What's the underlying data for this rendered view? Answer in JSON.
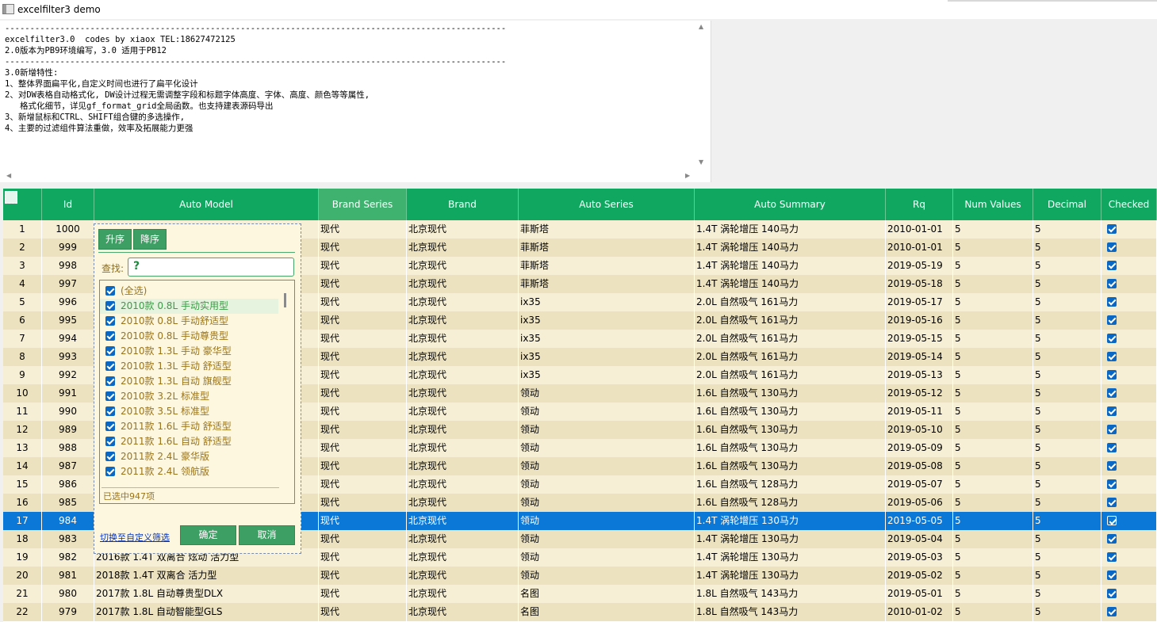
{
  "window": {
    "title": "excelfilter3 demo"
  },
  "memo": {
    "lines": [
      "----------------------------------------------------------------------------------------------------",
      "excelfilter3.0  codes by xiaox TEL:18627472125",
      "2.0版本为PB9环境编写，3.0 适用于PB12",
      "----------------------------------------------------------------------------------------------------",
      "3.0新增特性:",
      "1、整体界面扁平化,自定义时间也进行了扁平化设计",
      "2、对DW表格自动格式化, DW设计过程无需调整字段和标题字体高度、字体、高度、颜色等等属性,",
      "   格式化细节，详见gf_format_grid全局函数。也支持建表源码导出",
      "3、新增鼠标和CTRL、SHIFT组合键的多选操作,",
      "4、主要的过滤组件算法重做，效率及拓展能力更强"
    ]
  },
  "grid": {
    "headers": [
      "",
      "Id",
      "Auto Model",
      "Brand Series",
      "Brand",
      "Auto Series",
      "Auto Summary",
      "Rq",
      "Num Values",
      "Decimal Values",
      "Checked"
    ],
    "rows": [
      {
        "n": "1",
        "id": "1000",
        "model": "",
        "series": "现代",
        "brand": "北京现代",
        "auto": "菲斯塔",
        "summary": "1.4T 涡轮增压 140马力",
        "rq": "2010-01-01",
        "num": "5",
        "dec": "5",
        "checked": true
      },
      {
        "n": "2",
        "id": "999",
        "model": "",
        "series": "现代",
        "brand": "北京现代",
        "auto": "菲斯塔",
        "summary": "1.4T 涡轮增压 140马力",
        "rq": "2010-01-01",
        "num": "5",
        "dec": "5",
        "checked": true
      },
      {
        "n": "3",
        "id": "998",
        "model": "",
        "series": "现代",
        "brand": "北京现代",
        "auto": "菲斯塔",
        "summary": "1.4T 涡轮增压 140马力",
        "rq": "2019-05-19",
        "num": "5",
        "dec": "5",
        "checked": true
      },
      {
        "n": "4",
        "id": "997",
        "model": "",
        "series": "现代",
        "brand": "北京现代",
        "auto": "菲斯塔",
        "summary": "1.4T 涡轮增压 140马力",
        "rq": "2019-05-18",
        "num": "5",
        "dec": "5",
        "checked": true
      },
      {
        "n": "5",
        "id": "996",
        "model": "",
        "series": "现代",
        "brand": "北京现代",
        "auto": "ix35",
        "summary": "2.0L 自然吸气 161马力",
        "rq": "2019-05-17",
        "num": "5",
        "dec": "5",
        "checked": true
      },
      {
        "n": "6",
        "id": "995",
        "model": "",
        "series": "现代",
        "brand": "北京现代",
        "auto": "ix35",
        "summary": "2.0L 自然吸气 161马力",
        "rq": "2019-05-16",
        "num": "5",
        "dec": "5",
        "checked": true
      },
      {
        "n": "7",
        "id": "994",
        "model": "",
        "series": "现代",
        "brand": "北京现代",
        "auto": "ix35",
        "summary": "2.0L 自然吸气 161马力",
        "rq": "2019-05-15",
        "num": "5",
        "dec": "5",
        "checked": true
      },
      {
        "n": "8",
        "id": "993",
        "model": "",
        "series": "现代",
        "brand": "北京现代",
        "auto": "ix35",
        "summary": "2.0L 自然吸气 161马力",
        "rq": "2019-05-14",
        "num": "5",
        "dec": "5",
        "checked": true
      },
      {
        "n": "9",
        "id": "992",
        "model": "",
        "series": "现代",
        "brand": "北京现代",
        "auto": "ix35",
        "summary": "2.0L 自然吸气 161马力",
        "rq": "2019-05-13",
        "num": "5",
        "dec": "5",
        "checked": true
      },
      {
        "n": "10",
        "id": "991",
        "model": "",
        "series": "现代",
        "brand": "北京现代",
        "auto": "领动",
        "summary": "1.6L 自然吸气 130马力",
        "rq": "2019-05-12",
        "num": "5",
        "dec": "5",
        "checked": true
      },
      {
        "n": "11",
        "id": "990",
        "model": "",
        "series": "现代",
        "brand": "北京现代",
        "auto": "领动",
        "summary": "1.6L 自然吸气 130马力",
        "rq": "2019-05-11",
        "num": "5",
        "dec": "5",
        "checked": true
      },
      {
        "n": "12",
        "id": "989",
        "model": "",
        "series": "现代",
        "brand": "北京现代",
        "auto": "领动",
        "summary": "1.6L 自然吸气 130马力",
        "rq": "2019-05-10",
        "num": "5",
        "dec": "5",
        "checked": true
      },
      {
        "n": "13",
        "id": "988",
        "model": "",
        "series": "现代",
        "brand": "北京现代",
        "auto": "领动",
        "summary": "1.6L 自然吸气 130马力",
        "rq": "2019-05-09",
        "num": "5",
        "dec": "5",
        "checked": true
      },
      {
        "n": "14",
        "id": "987",
        "model": "",
        "series": "现代",
        "brand": "北京现代",
        "auto": "领动",
        "summary": "1.6L 自然吸气 130马力",
        "rq": "2019-05-08",
        "num": "5",
        "dec": "5",
        "checked": true
      },
      {
        "n": "15",
        "id": "986",
        "model": "",
        "series": "现代",
        "brand": "北京现代",
        "auto": "领动",
        "summary": "1.6L 自然吸气 128马力",
        "rq": "2019-05-07",
        "num": "5",
        "dec": "5",
        "checked": true
      },
      {
        "n": "16",
        "id": "985",
        "model": "",
        "series": "现代",
        "brand": "北京现代",
        "auto": "领动",
        "summary": "1.6L 自然吸气 128马力",
        "rq": "2019-05-06",
        "num": "5",
        "dec": "5",
        "checked": true
      },
      {
        "n": "17",
        "id": "984",
        "model": "",
        "series": "现代",
        "brand": "北京现代",
        "auto": "领动",
        "summary": "1.4T 涡轮增压 130马力",
        "rq": "2019-05-05",
        "num": "5",
        "dec": "5",
        "checked": true,
        "selected": true
      },
      {
        "n": "18",
        "id": "983",
        "model": "",
        "series": "现代",
        "brand": "北京现代",
        "auto": "领动",
        "summary": "1.4T 涡轮增压 130马力",
        "rq": "2019-05-04",
        "num": "5",
        "dec": "5",
        "checked": true
      },
      {
        "n": "19",
        "id": "982",
        "model": "2016款 1.4T 双离合 炫动 活力型",
        "series": "现代",
        "brand": "北京现代",
        "auto": "领动",
        "summary": "1.4T 涡轮增压 130马力",
        "rq": "2019-05-03",
        "num": "5",
        "dec": "5",
        "checked": true
      },
      {
        "n": "20",
        "id": "981",
        "model": "2018款 1.4T 双离合 活力型",
        "series": "现代",
        "brand": "北京现代",
        "auto": "领动",
        "summary": "1.4T 涡轮增压 130马力",
        "rq": "2019-05-02",
        "num": "5",
        "dec": "5",
        "checked": true
      },
      {
        "n": "21",
        "id": "980",
        "model": "2017款 1.8L 自动尊贵型DLX",
        "series": "现代",
        "brand": "北京现代",
        "auto": "名图",
        "summary": "1.8L 自然吸气 143马力",
        "rq": "2019-05-01",
        "num": "5",
        "dec": "5",
        "checked": true
      },
      {
        "n": "22",
        "id": "979",
        "model": "2017款 1.8L 自动智能型GLS",
        "series": "现代",
        "brand": "北京现代",
        "auto": "名图",
        "summary": "1.8L 自然吸气 143马力",
        "rq": "2010-01-02",
        "num": "5",
        "dec": "5",
        "checked": true
      }
    ]
  },
  "filter": {
    "asc_label": "升序",
    "desc_label": "降序",
    "search_label": "查找:",
    "search_placeholder": "?",
    "items": [
      "(全选)",
      "2010款 0.8L 手动实用型",
      "2010款 0.8L 手动舒适型",
      "2010款 0.8L 手动尊贵型",
      "2010款 1.3L 手动 豪华型",
      "2010款 1.3L 手动 舒适型",
      "2010款 1.3L 自动 旗舰型",
      "2010款 3.2L 标准型",
      "2010款 3.5L 标准型",
      "2011款 1.6L 手动 舒适型",
      "2011款 1.6L 自动 舒适型",
      "2011款 2.4L 豪华版",
      "2011款 2.4L 领航版"
    ],
    "status": "已选中947项",
    "custom_link": "切换至自定义筛选",
    "ok_label": "确定",
    "cancel_label": "取消"
  },
  "colors": {
    "header": "#10a860",
    "row_odd": "#f6efd5",
    "row_even": "#ece2c0",
    "selected": "#0b78d7",
    "panel_button": "#3d9f63"
  }
}
